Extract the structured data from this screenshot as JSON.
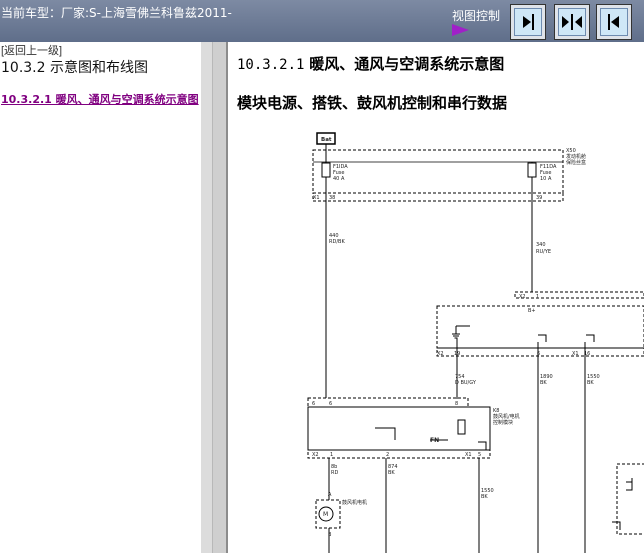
{
  "header": {
    "car_title": "当前车型：厂家:S-上海雪佛兰科鲁兹2011-",
    "view_control_label": "视图控制",
    "view_buttons": [
      {
        "name": "show-right-pane",
        "icon": "arrow-right-to-bar-icon"
      },
      {
        "name": "split-view",
        "icon": "split-arrows-icon"
      },
      {
        "name": "show-left-pane",
        "icon": "arrow-left-to-bar-icon"
      }
    ]
  },
  "sidebar": {
    "back_link": "[返回上一级]",
    "section_title": "10.3.2 示意图和布线图",
    "items": [
      {
        "label": "10.3.2.1 暖风、通风与空调系统示意图"
      }
    ]
  },
  "main": {
    "title_number": "10.3.2.1",
    "title_text": "暖风、通风与空调系统示意图",
    "subtitle": "模块电源、搭铁、鼓风机控制和串行数据"
  },
  "diagram": {
    "top_box_label": "Bat",
    "fuse_left": [
      "F1IDA",
      "Fuse",
      "40 A"
    ],
    "fuse_right": [
      "F11DA",
      "Fuse",
      "10 A"
    ],
    "fuse_block_label": [
      "X50",
      "发动机舱",
      "保险丝盒"
    ],
    "pins_top": [
      "38",
      "39"
    ],
    "connector_x1": "X1",
    "wire_left": [
      "440",
      "RD/BK"
    ],
    "wire_right": [
      "340",
      "RU/YE"
    ],
    "x2_label": "X2",
    "pin_1": "1",
    "bplus": "B+",
    "lower_pins": [
      {
        "conn": "X2",
        "pin": "19"
      },
      {
        "conn": "",
        "pin": "6"
      },
      {
        "conn": "X1",
        "pin": "16"
      }
    ],
    "wire_mid": [
      "754",
      "D BU/GY"
    ],
    "wire_gnd1": [
      "1890",
      "BK"
    ],
    "wire_gnd2": [
      "1550",
      "BK"
    ],
    "module_pins_top": [
      "6",
      "8"
    ],
    "module_label": [
      "K8",
      "鼓风机/电机",
      "控制模块"
    ],
    "module_pins_bottom": [
      {
        "conn": "X2",
        "pin": "1"
      },
      {
        "conn": "",
        "pin": "2"
      },
      {
        "conn": "X1",
        "pin": "5"
      }
    ],
    "wire_a": [
      "8b",
      "RD"
    ],
    "wire_b": [
      "874",
      "BK"
    ],
    "wire_c": [
      "1550",
      "BK"
    ],
    "motor_pin_top": "A",
    "motor_pin_bottom": "B",
    "motor_label": [
      "M",
      "鼓风机电机"
    ]
  }
}
